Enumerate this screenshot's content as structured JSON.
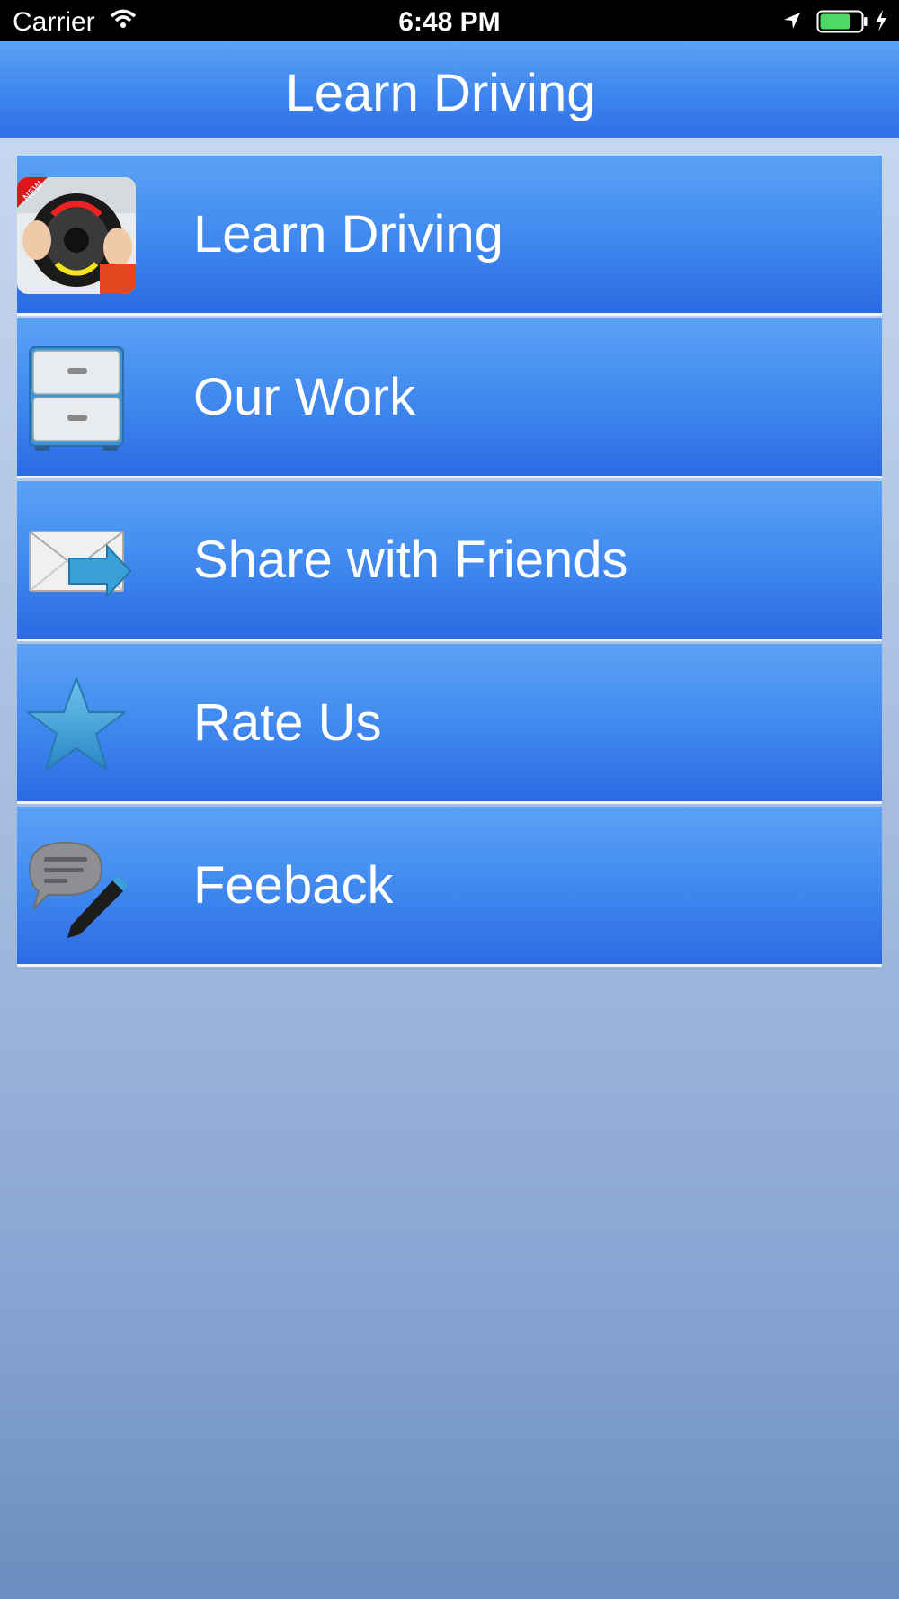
{
  "status_bar": {
    "carrier": "Carrier",
    "time": "6:48 PM",
    "battery_fill": 0.75,
    "battery_color": "#4cd964"
  },
  "nav_bar": {
    "title": "Learn Driving",
    "color": "#3f86ee"
  },
  "menu": {
    "items": [
      {
        "label": "Learn Driving",
        "icon": "steering-wheel-app-icon"
      },
      {
        "label": "Our Work",
        "icon": "file-cabinet-icon"
      },
      {
        "label": "Share with Friends",
        "icon": "mail-share-icon"
      },
      {
        "label": "Rate Us",
        "icon": "star-icon"
      },
      {
        "label": "Feeback",
        "icon": "feedback-pencil-icon"
      }
    ]
  }
}
